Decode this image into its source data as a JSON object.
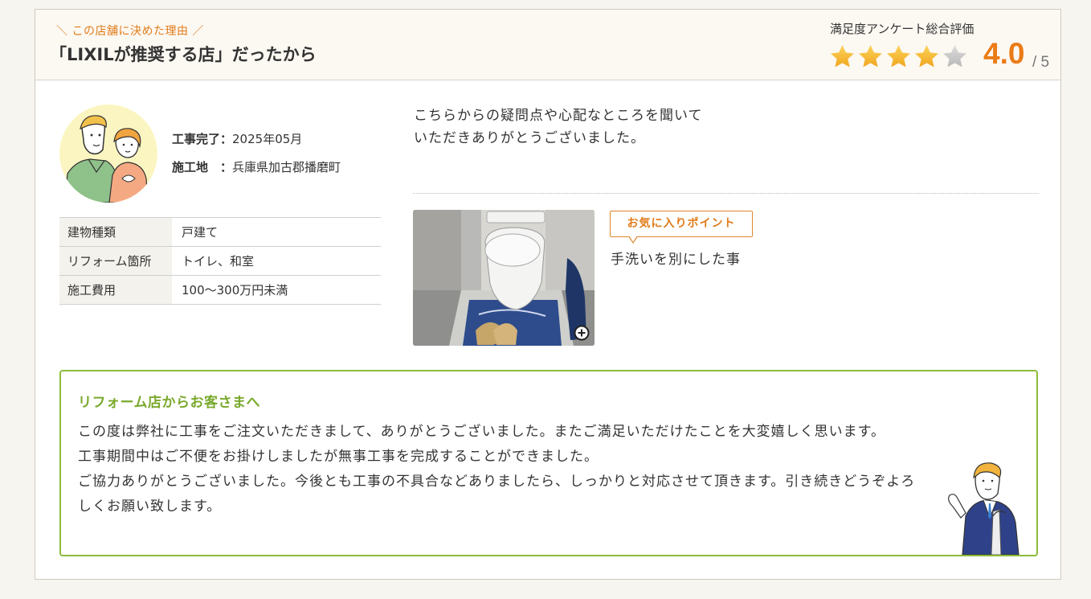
{
  "header": {
    "reason_label": "＼ この店舗に決めた理由 ／",
    "reason_title": "「LIXILが推奨する店」だったから",
    "rating_label": "満足度アンケート総合評価",
    "score": "4.0",
    "score_max": "/ 5",
    "rating": 4,
    "rating_out_of": 5
  },
  "profile": {
    "done_label": "工事完了：",
    "done_value": "2025年05月",
    "place_label": "施工地　：",
    "place_value": "兵庫県加古郡播磨町"
  },
  "details": [
    {
      "label": "建物種類",
      "value": "戸建て"
    },
    {
      "label": "リフォーム箇所",
      "value": "トイレ、和室"
    },
    {
      "label": "施工費用",
      "value": "100〜300万円未満"
    }
  ],
  "comment": {
    "line1": "こちらからの疑問点や心配なところを聞いて",
    "line2": "いただきありがとうございました。"
  },
  "favorite": {
    "tag": "お気に入りポイント",
    "text": "手洗いを別にした事"
  },
  "message": {
    "title": "リフォーム店からお客さまへ",
    "p1": "この度は弊社に工事をご注文いただきまして、ありがとうございました。またご満足いただけたことを大変嬉しく思います。",
    "p2": "工事期間中はご不便をお掛けしましたが無事工事を完成することができました。",
    "p3": "ご協力ありがとうございました。今後とも工事の不具合などありましたら、しっかりと対応させて頂きます。引き続きどうぞよろしくお願い致します。"
  },
  "colors": {
    "accent_orange": "#ea7b16",
    "green_border": "#8cbb3a",
    "star_filled": "#f6b533",
    "star_empty": "#c9c9c9"
  }
}
